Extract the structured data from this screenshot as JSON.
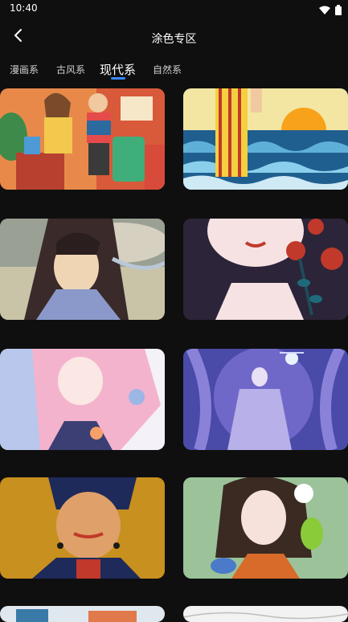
{
  "status": {
    "time": "10:40"
  },
  "appbar": {
    "title": "涂色专区"
  },
  "tabs": [
    {
      "label": "漫画系",
      "active": false
    },
    {
      "label": "古风系",
      "active": false
    },
    {
      "label": "现代系",
      "active": true
    },
    {
      "label": "自然系",
      "active": false
    }
  ],
  "icons": {
    "back": "chevron-left-icon",
    "wifi": "wifi-icon",
    "battery": "battery-icon"
  },
  "colors": {
    "background": "#0f0f0f",
    "accent": "#3b87ff"
  },
  "cards": [
    {
      "name": "girls-with-luggage"
    },
    {
      "name": "girl-in-yellow-dress-at-sea"
    },
    {
      "name": "ancient-man-portrait"
    },
    {
      "name": "woman-with-roses"
    },
    {
      "name": "pink-hair-character"
    },
    {
      "name": "fantasy-woman-with-orb"
    },
    {
      "name": "woman-in-blue-headscarf"
    },
    {
      "name": "girl-with-parrot"
    },
    {
      "name": "partial-card-left"
    },
    {
      "name": "partial-card-right"
    }
  ]
}
